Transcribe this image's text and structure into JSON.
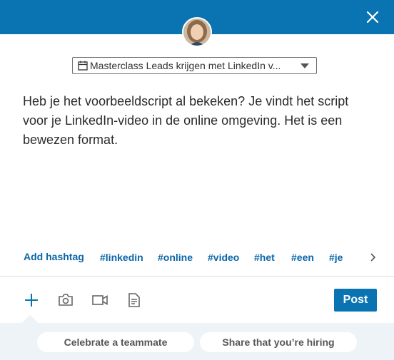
{
  "header": {
    "close_icon": "close-icon",
    "bar_color": "#0a73b1"
  },
  "author": {
    "avatar_icon": "profile-photo"
  },
  "audience": {
    "selected": "Masterclass Leads krijgen met LinkedIn v...",
    "icon": "calendar-icon"
  },
  "composer": {
    "text": "Heb je het voorbeeldscript al bekeken? Je vindt het script voor je LinkedIn-video in de online omgeving. Het is een bewezen format."
  },
  "hashtags": {
    "add_label": "Add hashtag",
    "suggestions": [
      "#linkedin",
      "#online",
      "#video",
      "#het",
      "#een",
      "#je"
    ]
  },
  "toolbar": {
    "icons": [
      "plus-icon",
      "camera-icon",
      "video-icon",
      "document-icon"
    ],
    "post_label": "Post",
    "accent": "#0a73b1"
  },
  "prompts": {
    "items": [
      "Celebrate a teammate",
      "Share that you’re hiring"
    ]
  }
}
